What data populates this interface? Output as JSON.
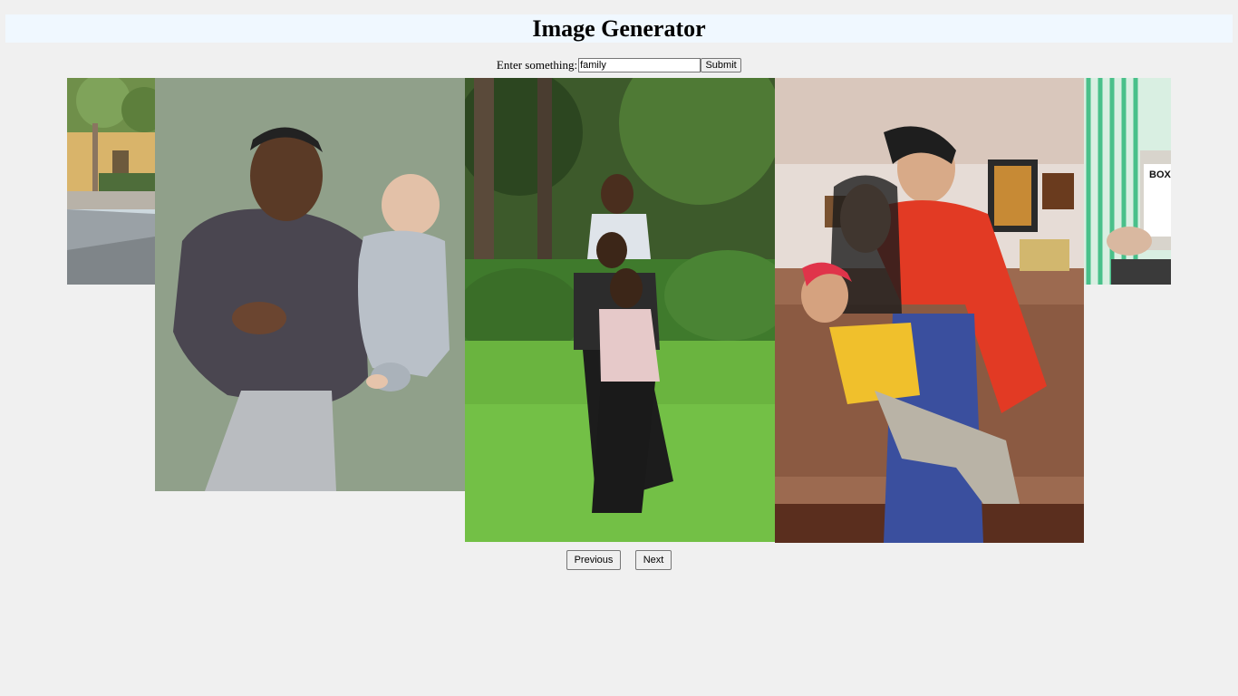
{
  "header": {
    "title": "Image Generator"
  },
  "search": {
    "label": "Enter something:",
    "value": "family",
    "submit_label": "Submit"
  },
  "gallery": {
    "images": [
      {
        "name": "photo-street-partial",
        "caption": ""
      },
      {
        "name": "photo-father-baby",
        "caption": ""
      },
      {
        "name": "photo-family-park",
        "caption": ""
      },
      {
        "name": "photo-family-hug",
        "caption": ""
      },
      {
        "name": "photo-striped-shirt-partial",
        "caption": ""
      }
    ],
    "side_photo_text": "BOXED WATER IS BETTER"
  },
  "pager": {
    "previous_label": "Previous",
    "next_label": "Next"
  }
}
